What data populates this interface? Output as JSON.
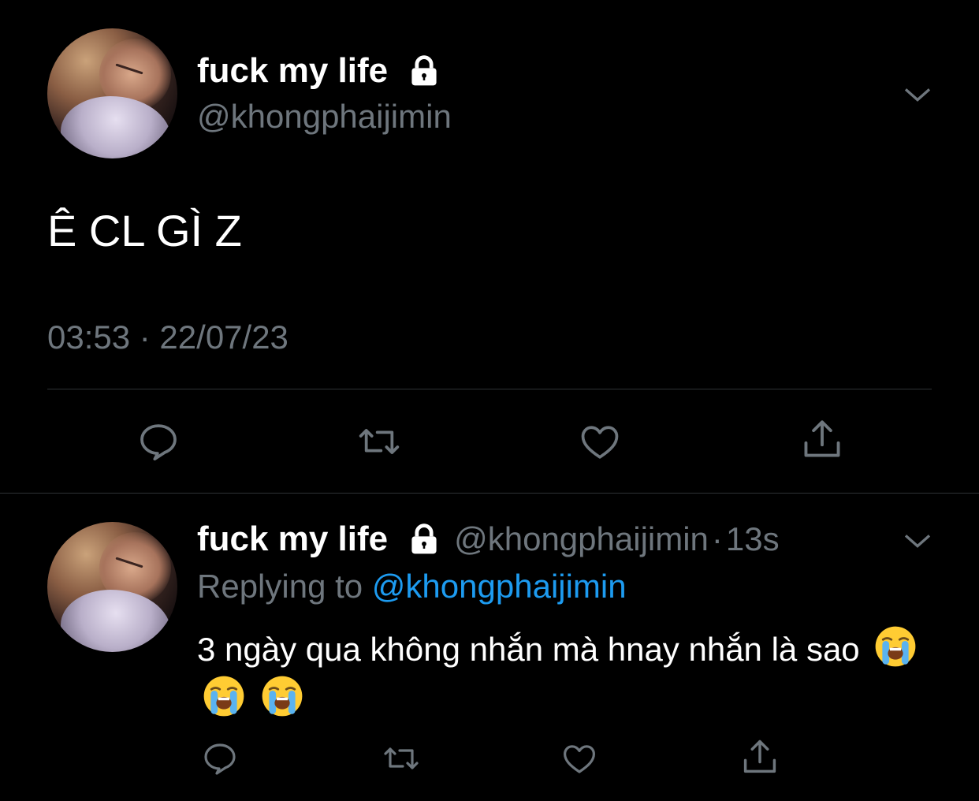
{
  "main_tweet": {
    "display_name": "fuck my life",
    "handle": "@khongphaijimin",
    "protected_icon": "lock-icon",
    "more_icon": "chevron-down-icon",
    "text": "Ê CL GÌ Z",
    "timestamp": "03:53 · 22/07/23",
    "actions": [
      "reply-icon",
      "retweet-icon",
      "like-icon",
      "share-icon"
    ]
  },
  "reply_tweet": {
    "display_name": "fuck my life",
    "handle": "@khongphaijimin",
    "separator": "·",
    "time_ago": "13s",
    "replying_prefix": "Replying to",
    "replying_to": "@khongphaijimin",
    "text": "3 ngày qua không nhắn mà hnay nhắn là sao",
    "emojis": [
      "loudly-crying-face",
      "loudly-crying-face",
      "loudly-crying-face"
    ],
    "actions": [
      "reply-icon",
      "retweet-icon",
      "like-icon",
      "share-icon"
    ]
  },
  "colors": {
    "background": "#000000",
    "primary_text": "#ffffff",
    "secondary_text": "#6e767d",
    "link": "#1d9bf0",
    "divider": "#2f3336"
  }
}
